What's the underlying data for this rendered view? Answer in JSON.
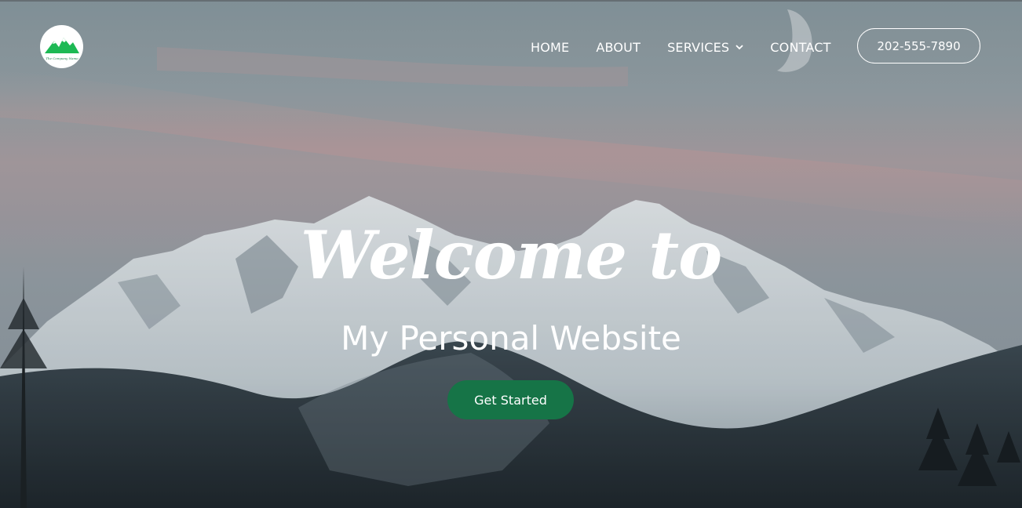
{
  "logo": {
    "text": "The Company Name",
    "icon": "mountain-logo-icon",
    "color": "#1db954"
  },
  "nav": {
    "items": [
      {
        "label": "HOME"
      },
      {
        "label": "ABOUT"
      },
      {
        "label": "SERVICES",
        "icon": "chevron-down-icon"
      },
      {
        "label": "CONTACT"
      }
    ]
  },
  "header": {
    "phone": "202-555-7890"
  },
  "hero": {
    "heading": "Welcome to",
    "subheading": "My Personal Website",
    "cta_label": "Get Started",
    "cta_color": "#167447"
  }
}
